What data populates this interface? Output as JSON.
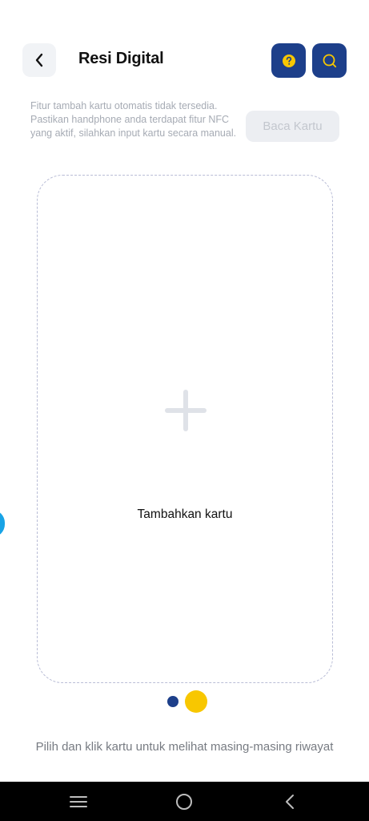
{
  "header": {
    "title": "Resi Digital",
    "back_icon": "chevron-left-icon",
    "help_icon": "question-circle-icon",
    "search_icon": "search-icon",
    "accent_color": "#1d3f8a",
    "highlight_color": "#f8c700"
  },
  "notice": {
    "text": "Fitur tambah kartu otomatis tidak tersedia. Pastikan handphone anda terdapat fitur NFC yang aktif, silahkan input kartu secara manual."
  },
  "read_card_button": {
    "label": "Baca Kartu",
    "disabled": true
  },
  "add_card": {
    "label": "Tambahkan kartu",
    "icon": "plus-icon"
  },
  "pagination": {
    "count": 2,
    "active_index": 1
  },
  "hint": {
    "text": "Pilih dan klik kartu untuk melihat masing-masing riwayat"
  },
  "system_nav": {
    "items": [
      "recent-apps-icon",
      "home-icon",
      "back-icon"
    ]
  }
}
